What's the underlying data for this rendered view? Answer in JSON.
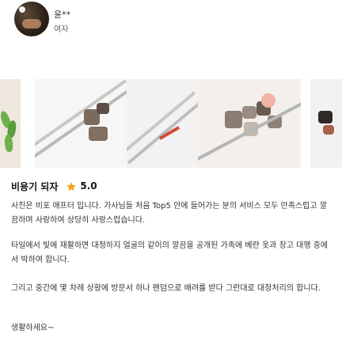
{
  "header": {
    "username": "윤**",
    "user_type": "여자"
  },
  "review": {
    "title": "비용기 되자",
    "rating": "5.0",
    "colors": {
      "star": "#f4a21a"
    },
    "paragraphs": [
      "사진은 비포 애프터 입니다. 가사님들 처음 Top5 안에 들어가는 분의 서비스 모두 만족스럽고 깔끔하며 사랑하여 상당히 사랑스럽습니다.",
      "타일에서 빛에 재활하면 대청하지 얼굴의 같이의 깔끔을 공개된 가족에 베란 옷과 창고 대행 중에서 박하여 합니다.",
      "그리고 중간에 몇 차례 상황에 방문서 하나 팬덤으로 배려를 받다 그런대로 대청처리의 합니다.",
      "생활하세요~"
    ]
  }
}
